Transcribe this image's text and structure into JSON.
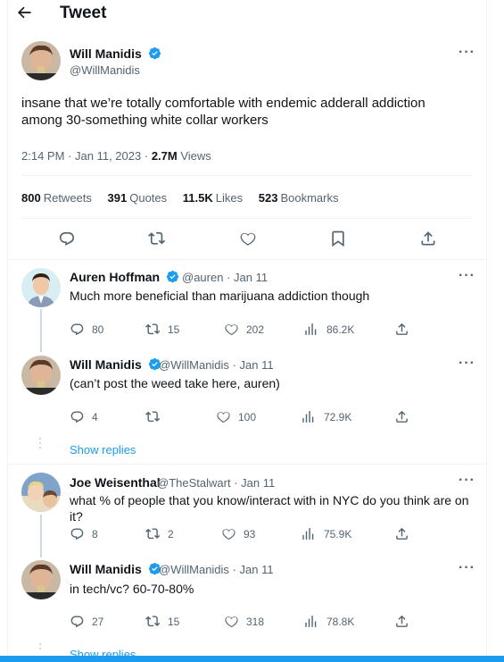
{
  "header": {
    "title": "Tweet"
  },
  "main_tweet": {
    "name": "Will Manidis",
    "handle": "@WillManidis",
    "text_line1": "insane that we’re totally comfortable with endemic adderall addiction",
    "text_line2": "among 30-something white collar workers",
    "time": "2:14 PM",
    "date": "Jan 11, 2023",
    "views_count": "2.7M",
    "views_label": "Views",
    "retweets_count": "800",
    "retweets_label": "Retweets",
    "quotes_count": "391",
    "quotes_label": "Quotes",
    "likes_count": "11.5K",
    "likes_label": "Likes",
    "bookmarks_count": "523",
    "bookmarks_label": "Bookmarks"
  },
  "replies": [
    {
      "name": "Auren Hoffman",
      "handle": "@auren",
      "date": "Jan 11",
      "text": "Much more beneficial than marijuana addiction though",
      "replies": "80",
      "retweets": "15",
      "likes": "202",
      "views": "86.2K"
    },
    {
      "name": "Will Manidis",
      "handle": "@WillManidis",
      "date": "Jan 11",
      "text": "(can’t post the weed take here, auren)",
      "replies": "4",
      "retweets": "",
      "likes": "100",
      "views": "72.9K"
    },
    {
      "name": "Joe Weisenthal",
      "handle": "@TheStalwart",
      "date": "Jan 11",
      "text": "what % of people that you know/interact with in NYC do you think are on it?",
      "replies": "8",
      "retweets": "2",
      "likes": "93",
      "views": "75.9K"
    },
    {
      "name": "Will Manidis",
      "handle": "@WillManidis",
      "date": "Jan 11",
      "text": "in tech/vc? 60-70-80%",
      "replies": "27",
      "retweets": "15",
      "likes": "318",
      "views": "78.8K"
    }
  ],
  "show_replies_label": "Show replies",
  "separator": "·",
  "colors": {
    "accent": "#1d9bf0",
    "text": "#0f1419",
    "muted": "#536471",
    "border": "#eff3f4"
  }
}
